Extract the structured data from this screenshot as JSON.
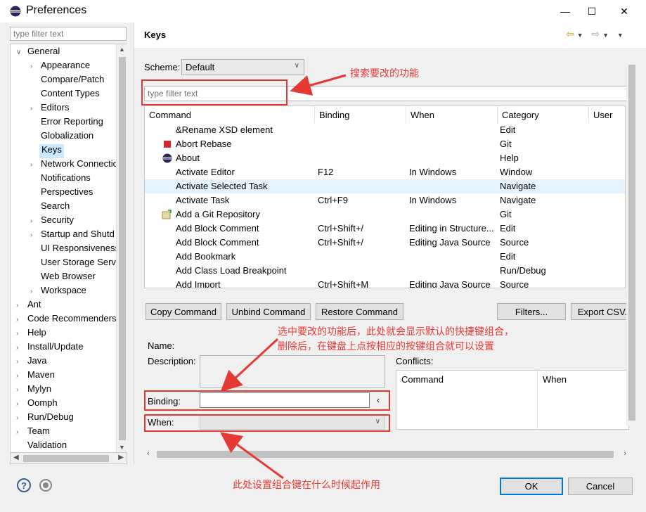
{
  "window": {
    "title": "Preferences"
  },
  "left": {
    "filter_placeholder": "type filter text",
    "tree": [
      "General",
      "Appearance",
      "Compare/Patch",
      "Content Types",
      "Editors",
      "Error Reporting",
      "Globalization",
      "Keys",
      "Network Connectio",
      "Notifications",
      "Perspectives",
      "Search",
      "Security",
      "Startup and Shutd",
      "UI Responsiveness",
      "User Storage Serv",
      "Web Browser",
      "Workspace",
      "Ant",
      "Code Recommenders",
      "Help",
      "Install/Update",
      "Java",
      "Maven",
      "Mylyn",
      "Oomph",
      "Run/Debug",
      "Team",
      "Validation"
    ]
  },
  "right": {
    "title": "Keys",
    "scheme_label": "Scheme:",
    "scheme_value": "Default",
    "filter_placeholder": "type filter text",
    "columns": [
      "Command",
      "Binding",
      "When",
      "Category",
      "User"
    ],
    "rows": [
      {
        "command": "&Rename XSD element",
        "binding": "",
        "when": "",
        "category": "Edit"
      },
      {
        "command": "Abort Rebase",
        "binding": "",
        "when": "",
        "category": "Git"
      },
      {
        "command": "About",
        "binding": "",
        "when": "",
        "category": "Help"
      },
      {
        "command": "Activate Editor",
        "binding": "F12",
        "when": "In Windows",
        "category": "Window"
      },
      {
        "command": "Activate Selected Task",
        "binding": "",
        "when": "",
        "category": "Navigate"
      },
      {
        "command": "Activate Task",
        "binding": "Ctrl+F9",
        "when": "In Windows",
        "category": "Navigate"
      },
      {
        "command": "Add a Git Repository",
        "binding": "",
        "when": "",
        "category": "Git"
      },
      {
        "command": "Add Block Comment",
        "binding": "Ctrl+Shift+/",
        "when": "Editing in Structure...",
        "category": "Edit"
      },
      {
        "command": "Add Block Comment",
        "binding": "Ctrl+Shift+/",
        "when": "Editing Java Source",
        "category": "Source"
      },
      {
        "command": "Add Bookmark",
        "binding": "",
        "when": "",
        "category": "Edit"
      },
      {
        "command": "Add Class Load Breakpoint",
        "binding": "",
        "when": "",
        "category": "Run/Debug"
      },
      {
        "command": "Add Import",
        "binding": "Ctrl+Shift+M",
        "when": "Editing Java Source",
        "category": "Source"
      }
    ],
    "buttons": {
      "copy": "Copy Command",
      "unbind": "Unbind Command",
      "restore": "Restore Command",
      "filters": "Filters...",
      "export": "Export CSV."
    },
    "name_label": "Name:",
    "description_label": "Description:",
    "binding_label": "Binding:",
    "when_label": "When:",
    "conflicts_label": "Conflicts:",
    "conflicts_columns": [
      "Command",
      "When"
    ]
  },
  "footer": {
    "ok": "OK",
    "cancel": "Cancel"
  },
  "annotations": {
    "search": "搜索要改的功能",
    "binding_line1": "选中要改的功能后，此处就会显示默认的快捷键组合，",
    "binding_line2": "删除后，在键盘上点按相应的按键组合就可以设置",
    "when": "此处设置组合键在什么时候起作用"
  }
}
